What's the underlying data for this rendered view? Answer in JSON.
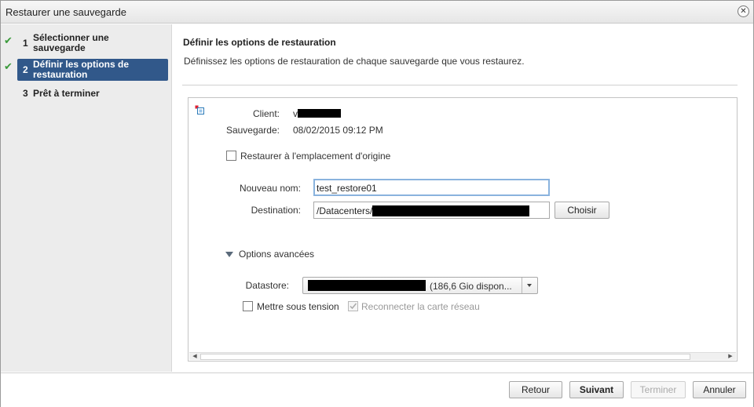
{
  "dialog": {
    "title": "Restaurer une sauvegarde"
  },
  "steps": [
    {
      "number": "1",
      "label_line1": "Sélectionner une",
      "label_line2": "sauvegarde",
      "state": "completed"
    },
    {
      "number": "2",
      "label_line1": "Définir les options de",
      "label_line2": "restauration",
      "state": "active"
    },
    {
      "number": "3",
      "label_line1": "Prêt à terminer",
      "label_line2": "",
      "state": "pending"
    }
  ],
  "main": {
    "title": "Définir les options de restauration",
    "description": "Définissez les options de restauration de chaque sauvegarde que vous restaurez."
  },
  "details": {
    "client_label": "Client:",
    "client_value": "v",
    "backup_label": "Sauvegarde:",
    "backup_value": "08/02/2015 09:12 PM"
  },
  "restore_original": {
    "label": "Restaurer à l'emplacement d'origine",
    "checked": false
  },
  "new_name": {
    "label": "Nouveau nom:",
    "value": "test_restore01"
  },
  "destination": {
    "label": "Destination:",
    "value": "/Datacenters/",
    "choose_label": "Choisir"
  },
  "advanced": {
    "label": "Options avancées",
    "expanded": true,
    "datastore_label": "Datastore:",
    "datastore_value": "(186,6 Gio dispon...",
    "power_on": {
      "label": "Mettre sous tension",
      "checked": false
    },
    "reconnect_nic": {
      "label": "Reconnecter la carte réseau",
      "checked": true,
      "disabled": true
    }
  },
  "footer": {
    "back": "Retour",
    "next": "Suivant",
    "finish": "Terminer",
    "cancel": "Annuler"
  },
  "colors": {
    "active_step_bg": "#31588a",
    "check_green": "#3a9a3a"
  }
}
